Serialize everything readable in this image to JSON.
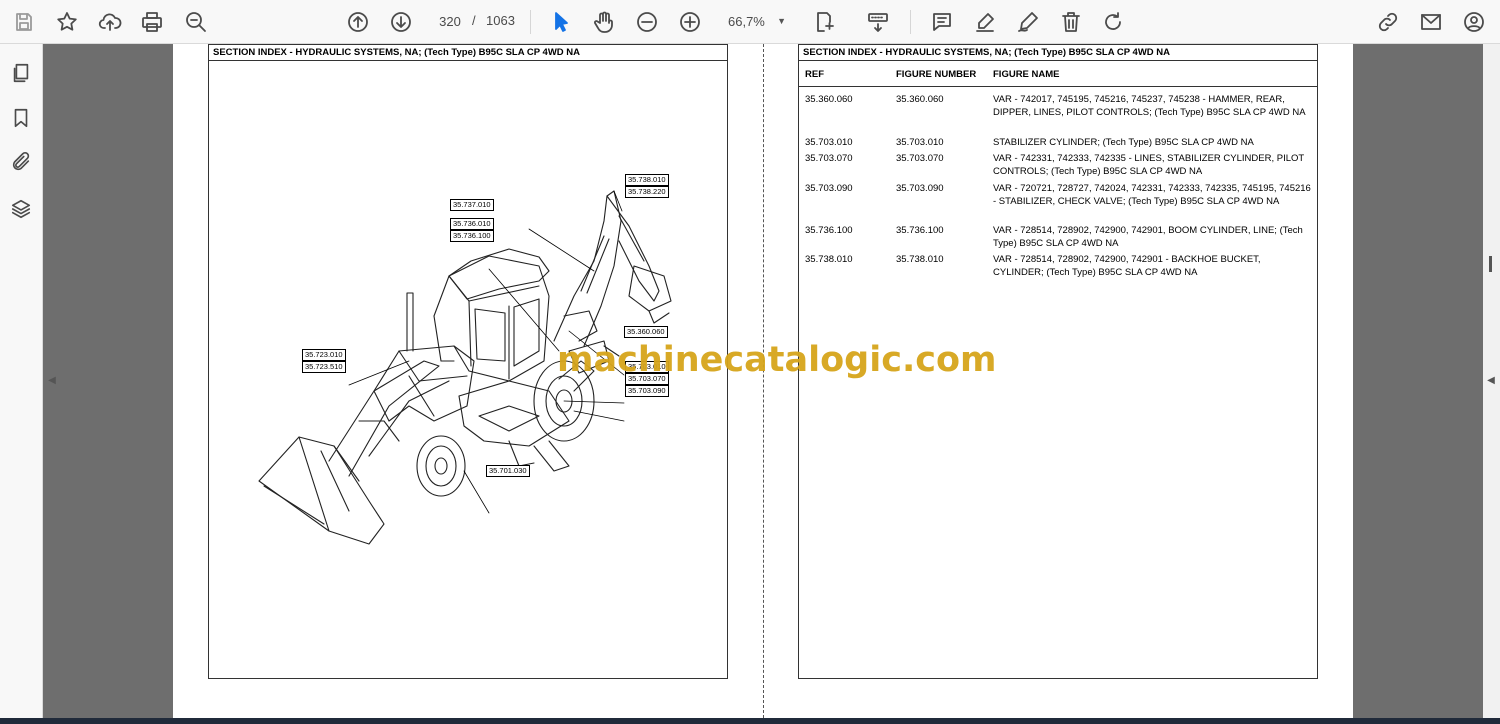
{
  "toolbar": {
    "current_page": "320",
    "page_separator": "/",
    "total_pages": "1063",
    "zoom": "66,7%"
  },
  "document": {
    "left_header": "SECTION INDEX - HYDRAULIC SYSTEMS, NA; (Tech Type) B95C SLA CP 4WD NA",
    "right_header": "SECTION INDEX - HYDRAULIC SYSTEMS, NA; (Tech Type) B95C SLA CP 4WD NA",
    "columns": [
      "REF",
      "FIGURE NUMBER",
      "FIGURE NAME"
    ],
    "rows": [
      {
        "ref": "35.360.060",
        "figure": "35.360.060",
        "name": "VAR - 742017, 745195, 745216, 745237, 745238 - HAMMER, REAR, DIPPER, LINES, PILOT CONTROLS; (Tech Type) B95C SLA CP 4WD NA"
      },
      {
        "ref": "35.703.010",
        "figure": "35.703.010",
        "name": "STABILIZER CYLINDER; (Tech Type) B95C SLA CP 4WD NA"
      },
      {
        "ref": "35.703.070",
        "figure": "35.703.070",
        "name": "VAR - 742331, 742333, 742335 - LINES, STABILIZER CYLINDER, PILOT CONTROLS; (Tech Type) B95C SLA CP 4WD NA"
      },
      {
        "ref": "35.703.090",
        "figure": "35.703.090",
        "name": "VAR - 720721, 728727, 742024, 742331, 742333, 742335, 745195, 745216 - STABILIZER, CHECK VALVE; (Tech Type) B95C SLA CP 4WD NA"
      },
      {
        "ref": "35.736.100",
        "figure": "35.736.100",
        "name": "VAR - 728514, 728902, 742900, 742901, BOOM CYLINDER, LINE; (Tech Type) B95C SLA CP 4WD NA"
      },
      {
        "ref": "35.738.010",
        "figure": "35.738.010",
        "name": "VAR - 728514, 728902, 742900, 742901 - BACKHOE BUCKET, CYLINDER; (Tech Type) B95C SLA CP 4WD NA"
      }
    ],
    "callouts": {
      "c1": "35.738.010",
      "c2": "35.738.220",
      "c3": "35.737.010",
      "c4": "35.736.010",
      "c5": "35.736.100",
      "c6": "35.360.060",
      "c7": "35.723.010",
      "c8": "35.723.510",
      "c9": "35.703.010",
      "c10": "35.703.070",
      "c11": "35.703.090",
      "c12": "35.701.030"
    },
    "watermark": "machinecatalogic.com"
  },
  "icons": {
    "toolbar": [
      "save-icon",
      "bookmark-star-icon",
      "upload-icon",
      "print-icon",
      "search-zoom-icon",
      "page-up-icon",
      "page-down-icon",
      "select-cursor-icon",
      "hand-icon",
      "zoom-out-icon",
      "zoom-in-icon",
      "page-fit-icon",
      "scroll-mode-icon",
      "comment-icon",
      "highlight-pen-icon",
      "sign-icon",
      "delete-icon",
      "redo-icon",
      "share-link-icon",
      "email-icon",
      "account-icon"
    ],
    "rail": [
      "pages-icon",
      "bookmarks-icon",
      "attachments-icon",
      "layers-icon"
    ]
  }
}
